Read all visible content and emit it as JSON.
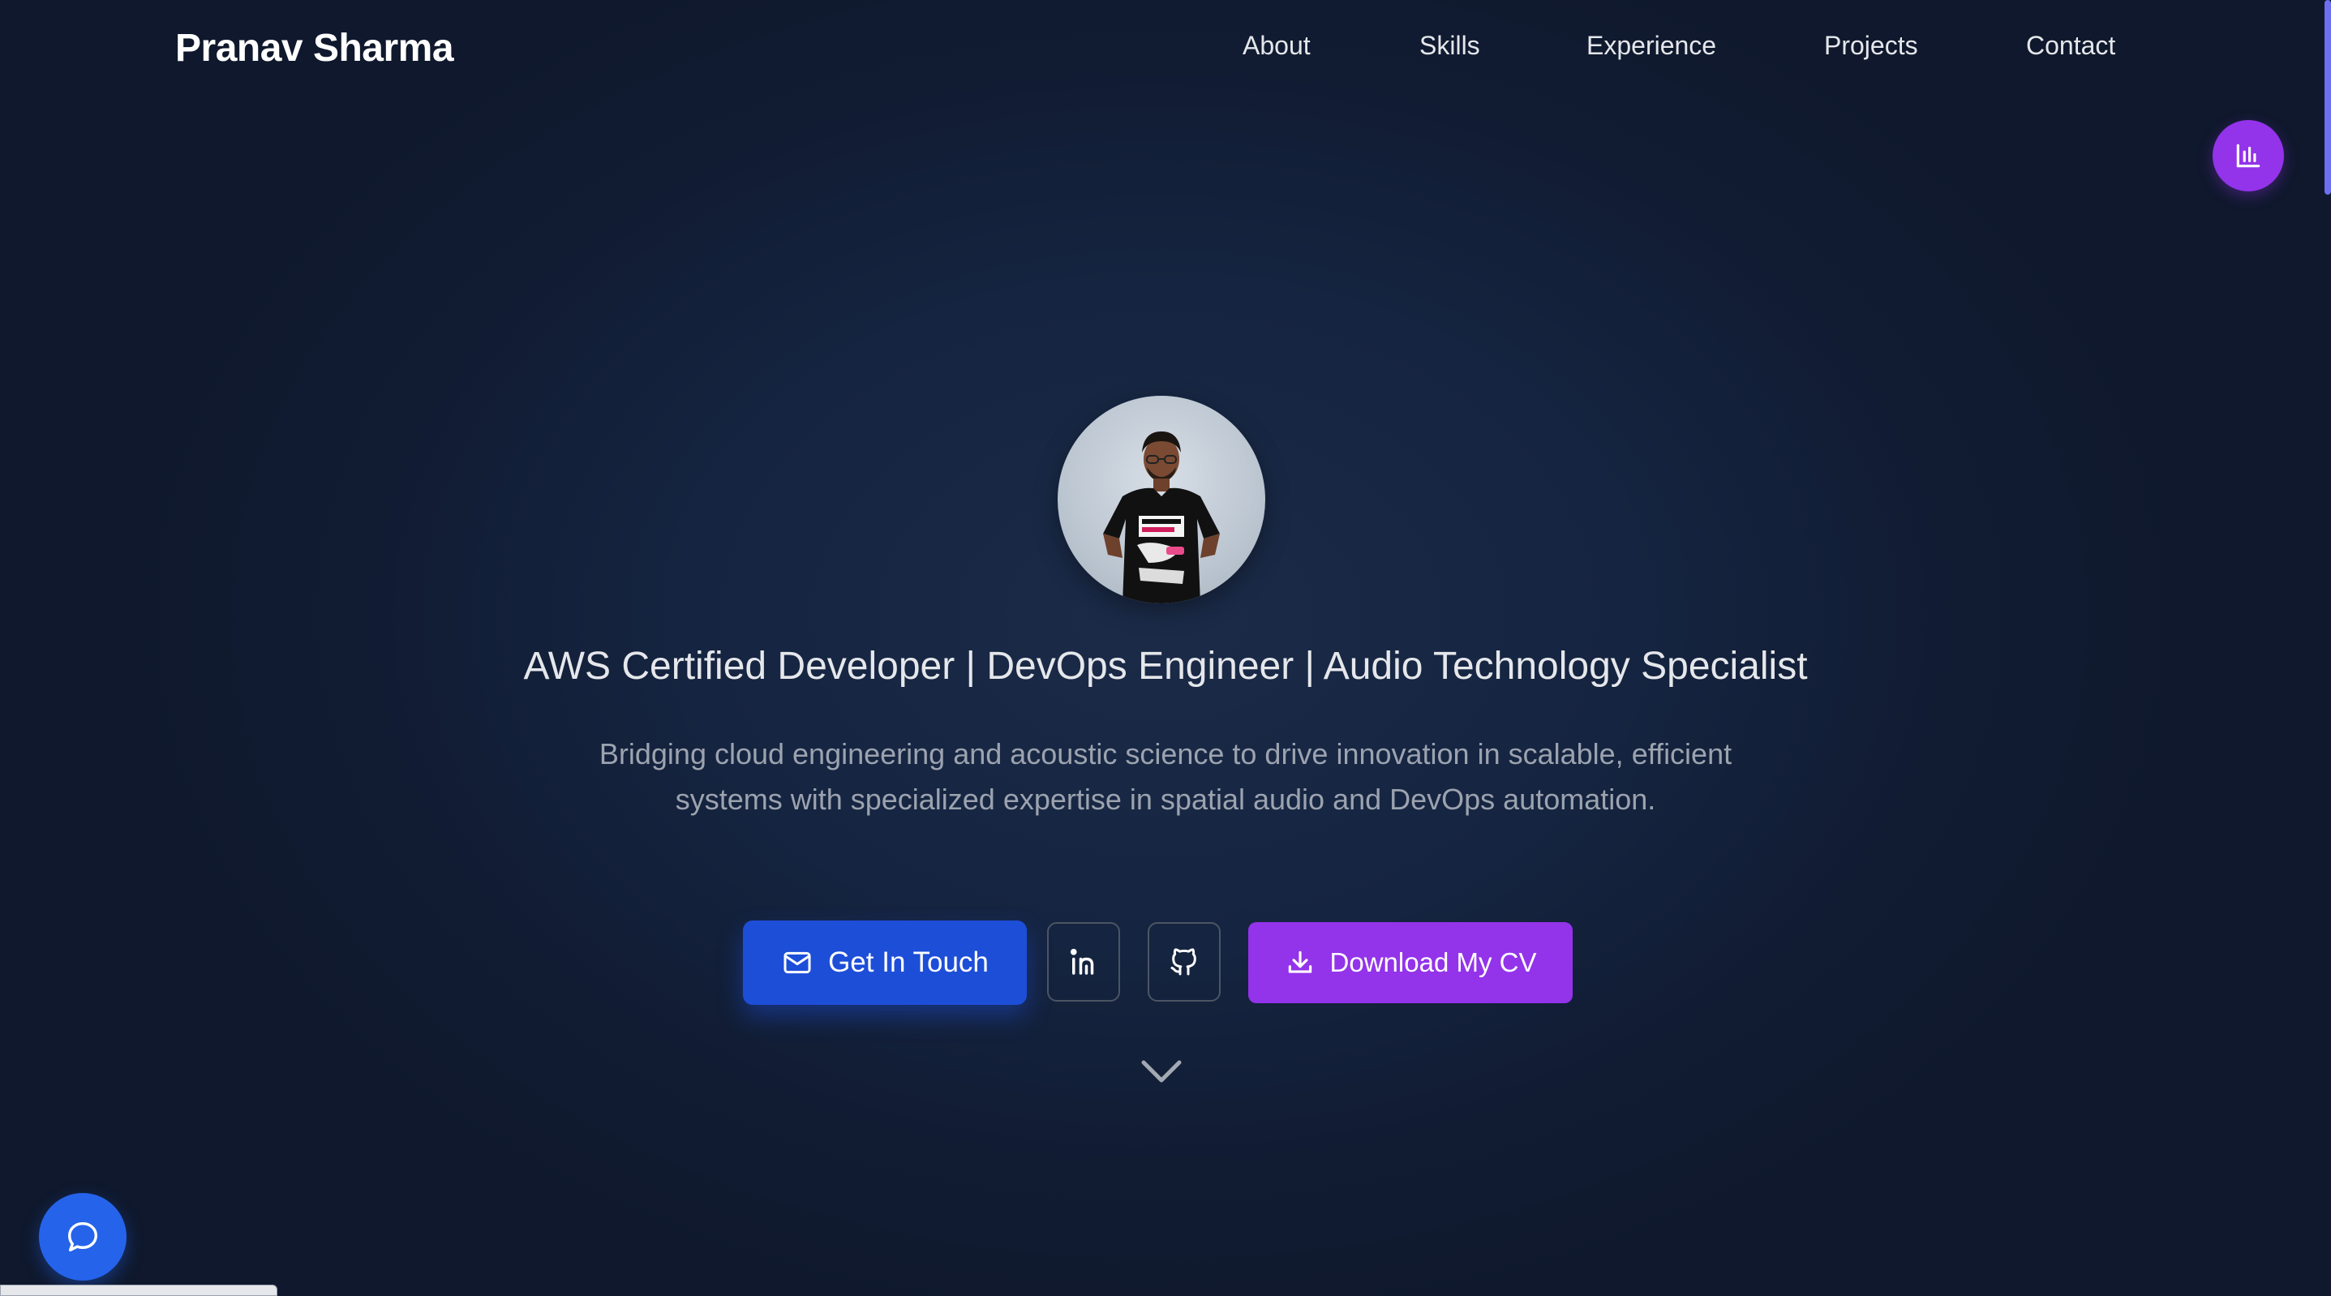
{
  "header": {
    "brand": "Pranav Sharma",
    "nav": [
      "About",
      "Skills",
      "Experience",
      "Projects",
      "Contact"
    ]
  },
  "hero": {
    "avatar_icon": "profile-photo",
    "title": "AWS Certified Developer | DevOps Engineer | Audio Technology Specialist",
    "description": "Bridging cloud engineering and acoustic science to drive innovation in scalable, efficient systems with specialized expertise in spatial audio and DevOps automation.",
    "buttons": {
      "contact": "Get In Touch",
      "linkedin_icon": "linkedin-icon",
      "github_icon": "github-icon",
      "cv": "Download My CV"
    }
  },
  "colors": {
    "background": "#131f38",
    "primary_button": "#1d4ed8",
    "cv_button": "#9333ea",
    "stats_button": "#9333ea",
    "chat_button": "#2563eb"
  },
  "icons": {
    "stats": "bar-chart-icon",
    "chat": "chat-bubble-icon",
    "scroll": "chevron-down-icon",
    "mail": "mail-icon",
    "download": "download-icon"
  }
}
